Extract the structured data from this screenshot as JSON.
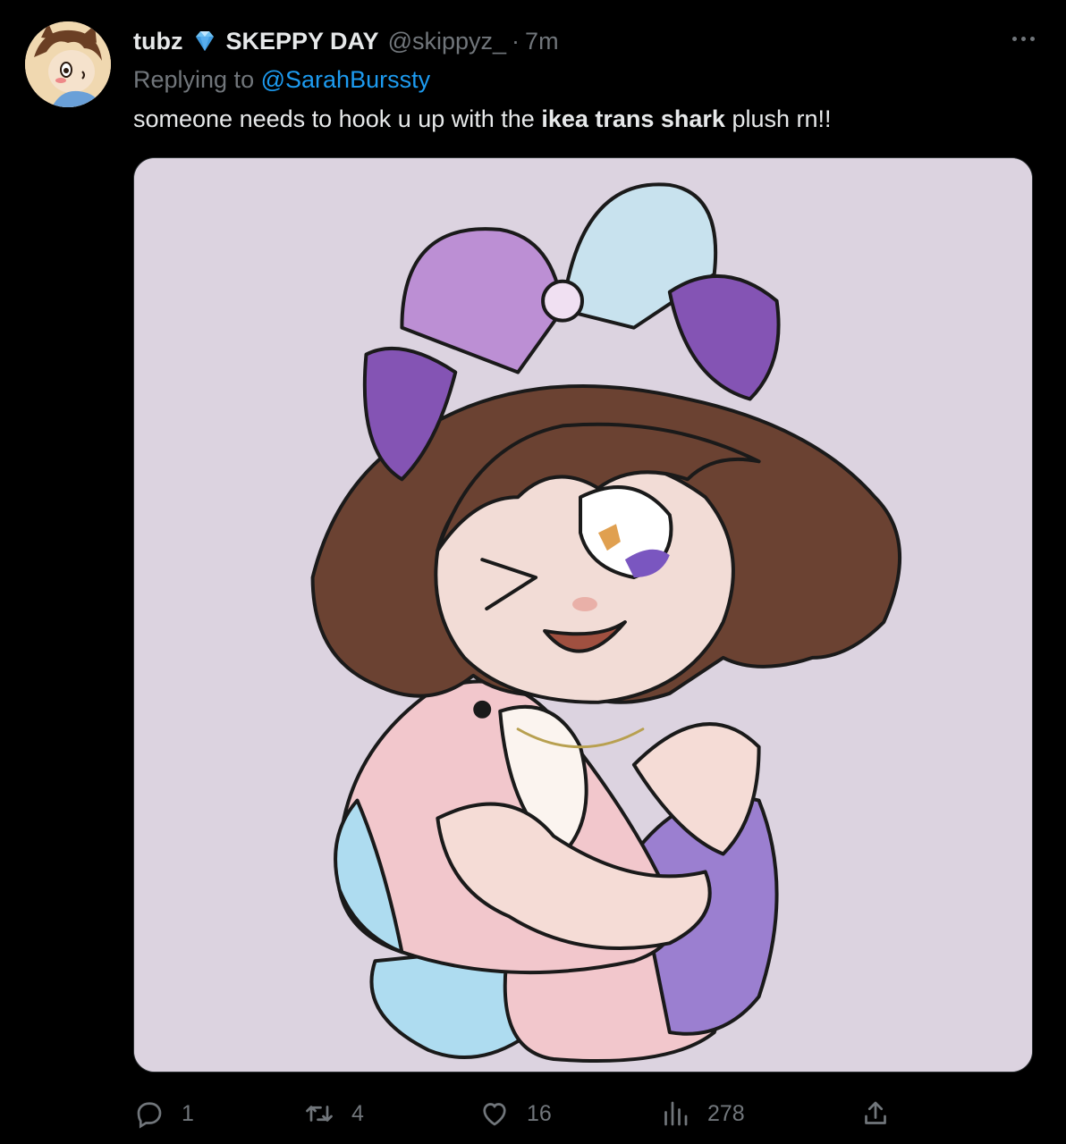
{
  "tweet": {
    "display_name": "tubz",
    "event_name": "SKEPPY DAY",
    "handle": "@skippyz_",
    "separator": "·",
    "time": "7m",
    "replying_prefix": "Replying to",
    "replying_to": "@SarahBurssty",
    "text_before": "someone needs to hook u up with the ",
    "text_bold": "ikea trans shark",
    "text_after": " plush rn!!"
  },
  "actions": {
    "reply_count": "1",
    "retweet_count": "4",
    "like_count": "16",
    "views_count": "278"
  },
  "icons": {
    "verified": "diamond-icon",
    "more": "more-dots-icon",
    "reply": "reply-icon",
    "retweet": "retweet-icon",
    "like": "heart-icon",
    "views": "views-icon",
    "share": "share-icon"
  },
  "colors": {
    "background": "#000000",
    "text": "#e7e9ea",
    "muted": "#71767b",
    "link": "#1d9bf0",
    "image_bg": "#dcd3e0"
  }
}
